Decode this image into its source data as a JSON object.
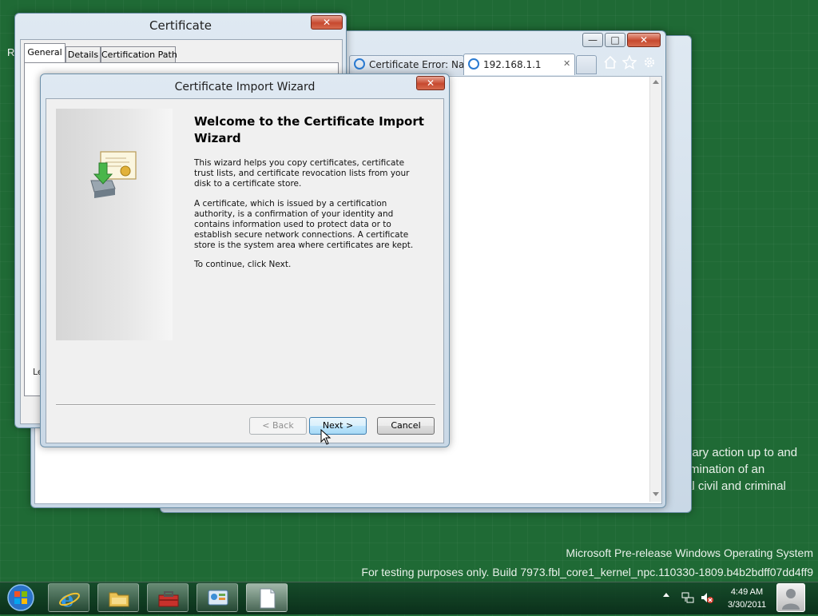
{
  "background_text": {
    "partial_top_left": "Re",
    "partial_cert_left": "Lea",
    "policy_lines": [
      "nary action up to and",
      "rmination of an",
      "al civil and criminal"
    ]
  },
  "watermark": {
    "line1": "Microsoft Pre-release Windows Operating System",
    "line2": "For testing purposes only. Build 7973.fbl_core1_kernel_npc.110330-1809.b4b2bdff07dd4ff9"
  },
  "browser": {
    "tabs": [
      {
        "label": "Certificate Error: Na...",
        "icon": "ie-icon"
      },
      {
        "label": "192.168.1.1",
        "icon": "ie-icon",
        "close": "✕"
      }
    ],
    "toolbar_icons": [
      "home-icon",
      "star-icon",
      "gear-icon"
    ],
    "caption": {
      "minimize": "—",
      "maximize": "□",
      "close": "✕"
    }
  },
  "certificate": {
    "title": "Certificate",
    "close": "✕",
    "tabs": [
      "General",
      "Details",
      "Certification Path"
    ],
    "active_tab": "General"
  },
  "wizard": {
    "title": "Certificate Import Wizard",
    "close": "✕",
    "heading": "Welcome to the Certificate Import Wizard",
    "para1": "This wizard helps you copy certificates, certificate trust lists, and certificate revocation lists from your disk to a certificate store.",
    "para2": "A certificate, which is issued by a certification authority, is a confirmation of your identity and contains information used to protect data or to establish secure network connections. A certificate store is the system area where certificates are kept.",
    "para3": "To continue, click Next.",
    "buttons": {
      "back": "< Back",
      "next": "Next >",
      "cancel": "Cancel"
    },
    "icon": "certificate-import-icon"
  },
  "taskbar": {
    "start": "start-orb-icon",
    "pinned": [
      "internet-explorer-icon",
      "file-explorer-icon",
      "toolbox-icon",
      "control-panel-icon",
      "document-icon"
    ],
    "tray_icons": [
      "show-hidden-icons-chevron",
      "network-icon",
      "volume-muted-icon"
    ],
    "time": "4:49 AM",
    "date": "3/30/2011",
    "user_icon": "user-avatar-icon"
  },
  "colors": {
    "desktop": "#1f6a35",
    "accent_blue": "#1e3a8a"
  }
}
